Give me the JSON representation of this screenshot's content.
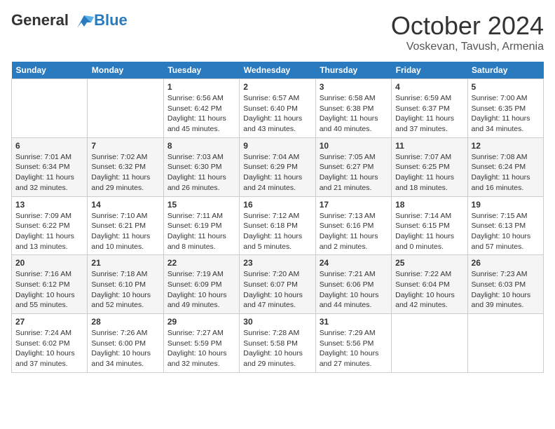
{
  "header": {
    "logo_line1": "General",
    "logo_line2": "Blue",
    "month": "October 2024",
    "location": "Voskevan, Tavush, Armenia"
  },
  "days_of_week": [
    "Sunday",
    "Monday",
    "Tuesday",
    "Wednesday",
    "Thursday",
    "Friday",
    "Saturday"
  ],
  "weeks": [
    [
      {
        "day": "",
        "sunrise": "",
        "sunset": "",
        "daylight": ""
      },
      {
        "day": "",
        "sunrise": "",
        "sunset": "",
        "daylight": ""
      },
      {
        "day": "1",
        "sunrise": "Sunrise: 6:56 AM",
        "sunset": "Sunset: 6:42 PM",
        "daylight": "Daylight: 11 hours and 45 minutes."
      },
      {
        "day": "2",
        "sunrise": "Sunrise: 6:57 AM",
        "sunset": "Sunset: 6:40 PM",
        "daylight": "Daylight: 11 hours and 43 minutes."
      },
      {
        "day": "3",
        "sunrise": "Sunrise: 6:58 AM",
        "sunset": "Sunset: 6:38 PM",
        "daylight": "Daylight: 11 hours and 40 minutes."
      },
      {
        "day": "4",
        "sunrise": "Sunrise: 6:59 AM",
        "sunset": "Sunset: 6:37 PM",
        "daylight": "Daylight: 11 hours and 37 minutes."
      },
      {
        "day": "5",
        "sunrise": "Sunrise: 7:00 AM",
        "sunset": "Sunset: 6:35 PM",
        "daylight": "Daylight: 11 hours and 34 minutes."
      }
    ],
    [
      {
        "day": "6",
        "sunrise": "Sunrise: 7:01 AM",
        "sunset": "Sunset: 6:34 PM",
        "daylight": "Daylight: 11 hours and 32 minutes."
      },
      {
        "day": "7",
        "sunrise": "Sunrise: 7:02 AM",
        "sunset": "Sunset: 6:32 PM",
        "daylight": "Daylight: 11 hours and 29 minutes."
      },
      {
        "day": "8",
        "sunrise": "Sunrise: 7:03 AM",
        "sunset": "Sunset: 6:30 PM",
        "daylight": "Daylight: 11 hours and 26 minutes."
      },
      {
        "day": "9",
        "sunrise": "Sunrise: 7:04 AM",
        "sunset": "Sunset: 6:29 PM",
        "daylight": "Daylight: 11 hours and 24 minutes."
      },
      {
        "day": "10",
        "sunrise": "Sunrise: 7:05 AM",
        "sunset": "Sunset: 6:27 PM",
        "daylight": "Daylight: 11 hours and 21 minutes."
      },
      {
        "day": "11",
        "sunrise": "Sunrise: 7:07 AM",
        "sunset": "Sunset: 6:25 PM",
        "daylight": "Daylight: 11 hours and 18 minutes."
      },
      {
        "day": "12",
        "sunrise": "Sunrise: 7:08 AM",
        "sunset": "Sunset: 6:24 PM",
        "daylight": "Daylight: 11 hours and 16 minutes."
      }
    ],
    [
      {
        "day": "13",
        "sunrise": "Sunrise: 7:09 AM",
        "sunset": "Sunset: 6:22 PM",
        "daylight": "Daylight: 11 hours and 13 minutes."
      },
      {
        "day": "14",
        "sunrise": "Sunrise: 7:10 AM",
        "sunset": "Sunset: 6:21 PM",
        "daylight": "Daylight: 11 hours and 10 minutes."
      },
      {
        "day": "15",
        "sunrise": "Sunrise: 7:11 AM",
        "sunset": "Sunset: 6:19 PM",
        "daylight": "Daylight: 11 hours and 8 minutes."
      },
      {
        "day": "16",
        "sunrise": "Sunrise: 7:12 AM",
        "sunset": "Sunset: 6:18 PM",
        "daylight": "Daylight: 11 hours and 5 minutes."
      },
      {
        "day": "17",
        "sunrise": "Sunrise: 7:13 AM",
        "sunset": "Sunset: 6:16 PM",
        "daylight": "Daylight: 11 hours and 2 minutes."
      },
      {
        "day": "18",
        "sunrise": "Sunrise: 7:14 AM",
        "sunset": "Sunset: 6:15 PM",
        "daylight": "Daylight: 11 hours and 0 minutes."
      },
      {
        "day": "19",
        "sunrise": "Sunrise: 7:15 AM",
        "sunset": "Sunset: 6:13 PM",
        "daylight": "Daylight: 10 hours and 57 minutes."
      }
    ],
    [
      {
        "day": "20",
        "sunrise": "Sunrise: 7:16 AM",
        "sunset": "Sunset: 6:12 PM",
        "daylight": "Daylight: 10 hours and 55 minutes."
      },
      {
        "day": "21",
        "sunrise": "Sunrise: 7:18 AM",
        "sunset": "Sunset: 6:10 PM",
        "daylight": "Daylight: 10 hours and 52 minutes."
      },
      {
        "day": "22",
        "sunrise": "Sunrise: 7:19 AM",
        "sunset": "Sunset: 6:09 PM",
        "daylight": "Daylight: 10 hours and 49 minutes."
      },
      {
        "day": "23",
        "sunrise": "Sunrise: 7:20 AM",
        "sunset": "Sunset: 6:07 PM",
        "daylight": "Daylight: 10 hours and 47 minutes."
      },
      {
        "day": "24",
        "sunrise": "Sunrise: 7:21 AM",
        "sunset": "Sunset: 6:06 PM",
        "daylight": "Daylight: 10 hours and 44 minutes."
      },
      {
        "day": "25",
        "sunrise": "Sunrise: 7:22 AM",
        "sunset": "Sunset: 6:04 PM",
        "daylight": "Daylight: 10 hours and 42 minutes."
      },
      {
        "day": "26",
        "sunrise": "Sunrise: 7:23 AM",
        "sunset": "Sunset: 6:03 PM",
        "daylight": "Daylight: 10 hours and 39 minutes."
      }
    ],
    [
      {
        "day": "27",
        "sunrise": "Sunrise: 7:24 AM",
        "sunset": "Sunset: 6:02 PM",
        "daylight": "Daylight: 10 hours and 37 minutes."
      },
      {
        "day": "28",
        "sunrise": "Sunrise: 7:26 AM",
        "sunset": "Sunset: 6:00 PM",
        "daylight": "Daylight: 10 hours and 34 minutes."
      },
      {
        "day": "29",
        "sunrise": "Sunrise: 7:27 AM",
        "sunset": "Sunset: 5:59 PM",
        "daylight": "Daylight: 10 hours and 32 minutes."
      },
      {
        "day": "30",
        "sunrise": "Sunrise: 7:28 AM",
        "sunset": "Sunset: 5:58 PM",
        "daylight": "Daylight: 10 hours and 29 minutes."
      },
      {
        "day": "31",
        "sunrise": "Sunrise: 7:29 AM",
        "sunset": "Sunset: 5:56 PM",
        "daylight": "Daylight: 10 hours and 27 minutes."
      },
      {
        "day": "",
        "sunrise": "",
        "sunset": "",
        "daylight": ""
      },
      {
        "day": "",
        "sunrise": "",
        "sunset": "",
        "daylight": ""
      }
    ]
  ]
}
